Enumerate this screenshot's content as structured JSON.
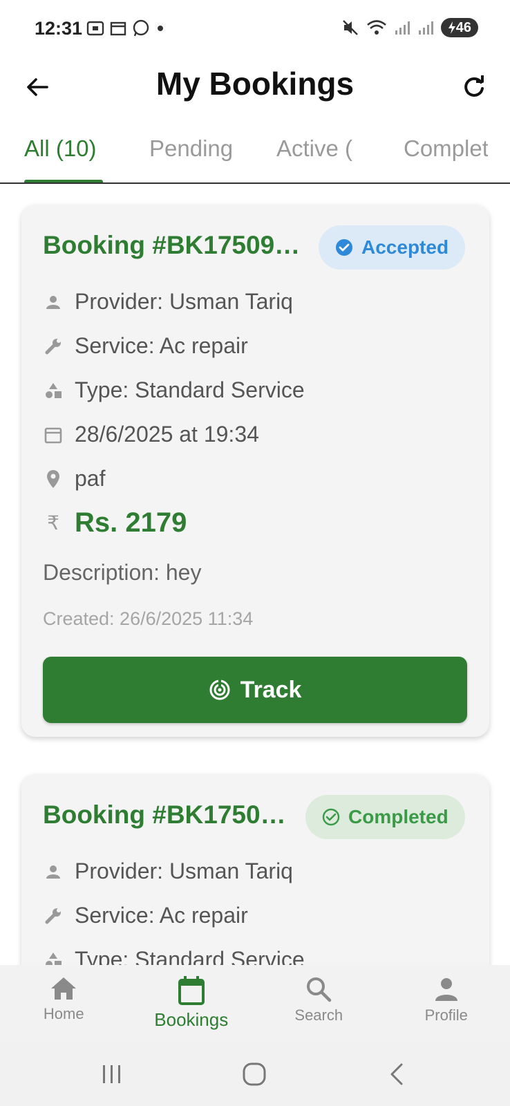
{
  "status": {
    "time": "12:31",
    "battery": "46"
  },
  "header": {
    "title": "My Bookings"
  },
  "tabs": [
    {
      "label": "All (10)"
    },
    {
      "label": "Pending"
    },
    {
      "label": "Active ("
    },
    {
      "label": "Completed"
    }
  ],
  "bookings": [
    {
      "title": "Booking #BK17509…",
      "status": "Accepted",
      "provider": "Provider: Usman Tariq",
      "service": "Service: Ac repair",
      "type": "Type: Standard Service",
      "datetime": "28/6/2025 at 19:34",
      "location": "paf",
      "price": "Rs. 2179",
      "description": "Description: hey",
      "created": "Created: 26/6/2025 11:34",
      "action": "Track"
    },
    {
      "title": "Booking #BK1750…",
      "status": "Completed",
      "provider": "Provider: Usman Tariq",
      "service": "Service: Ac repair",
      "type": "Type: Standard Service"
    }
  ],
  "bottom_nav": [
    {
      "label": "Home",
      "icon": "home-icon"
    },
    {
      "label": "Bookings",
      "icon": "calendar-icon"
    },
    {
      "label": "Search",
      "icon": "search-icon"
    },
    {
      "label": "Profile",
      "icon": "person-icon"
    }
  ],
  "colors": {
    "primary": "#2e7d32",
    "accepted": "#2e8ad8",
    "completed": "#3b9a48"
  }
}
